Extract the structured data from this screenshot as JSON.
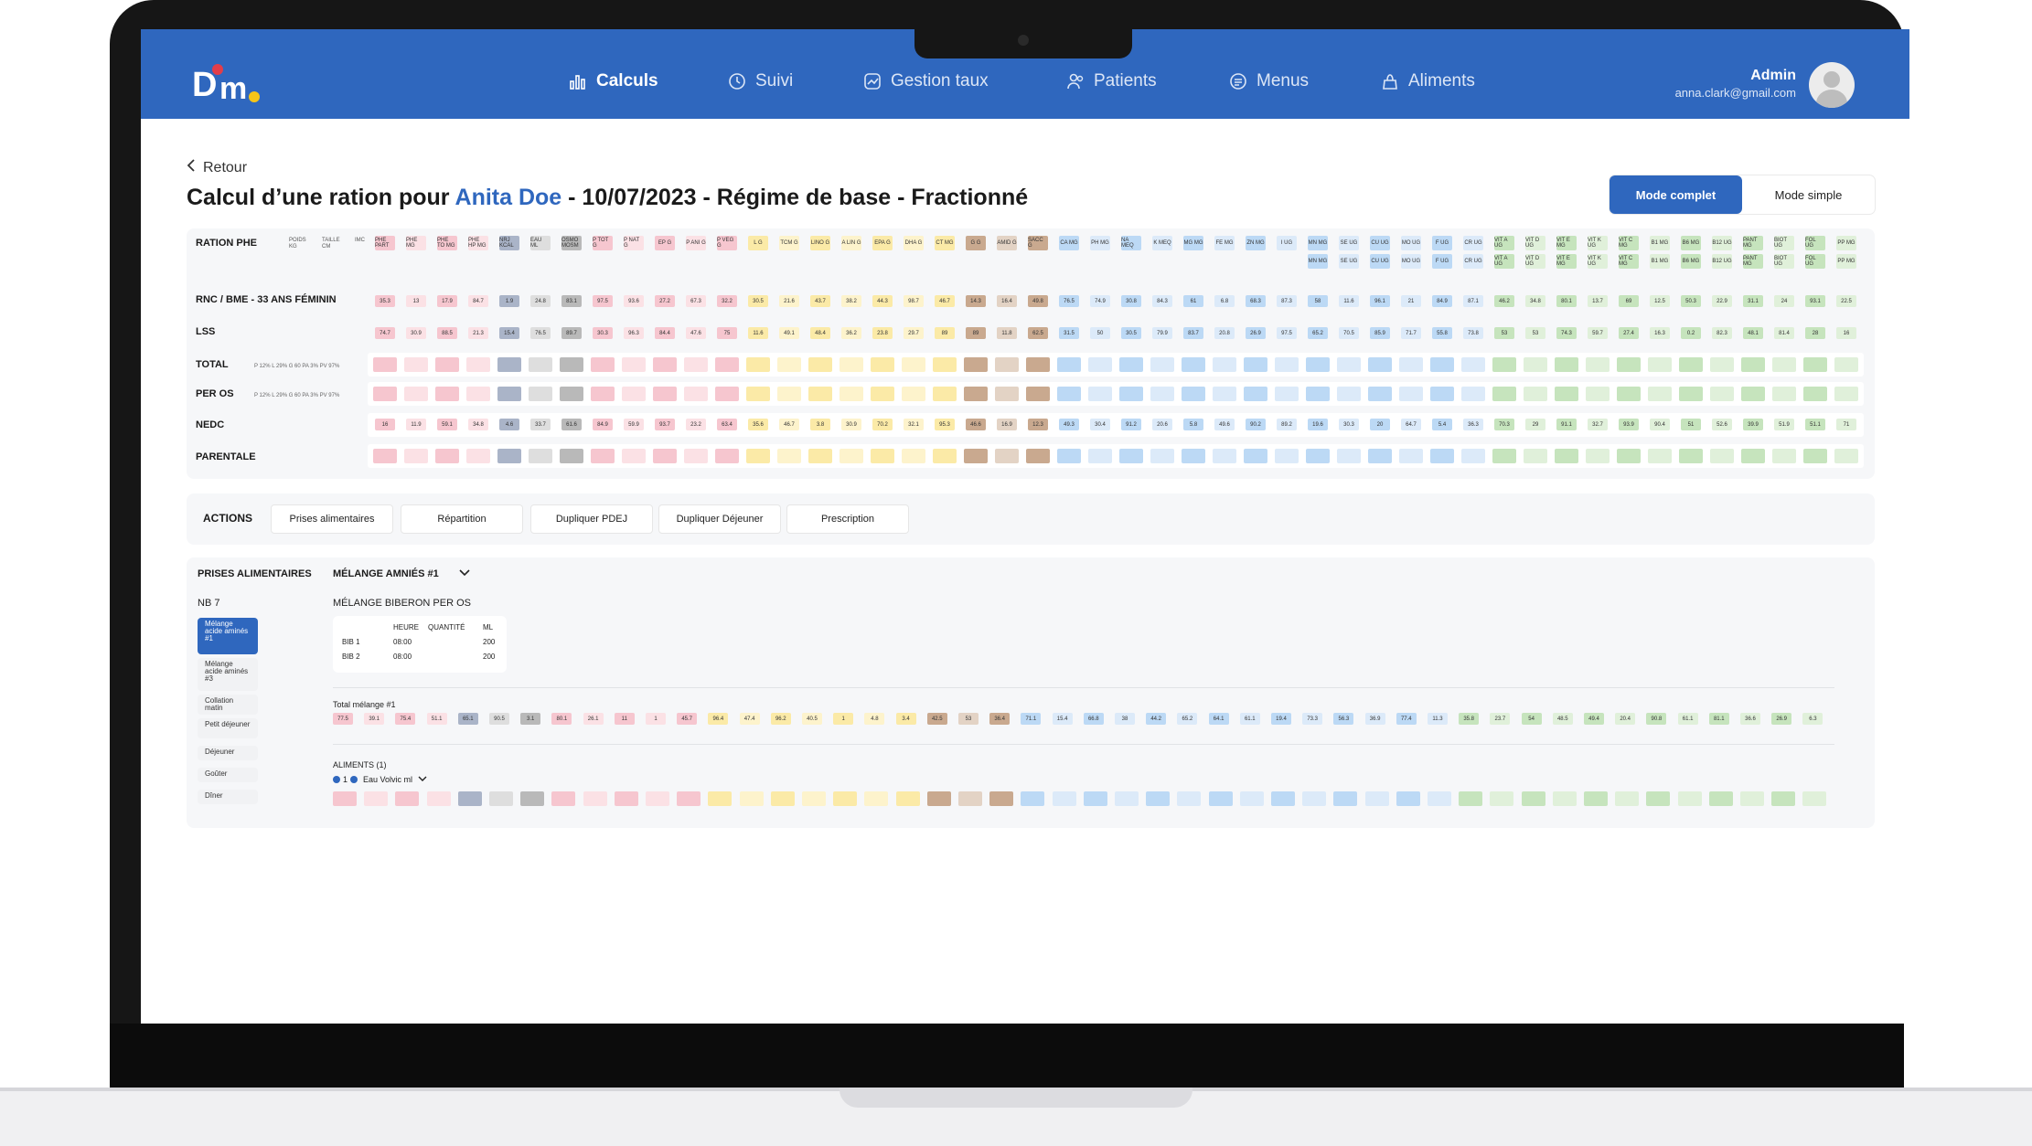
{
  "header": {
    "nav": [
      {
        "label": "Calculs",
        "icon": "bar-chart-icon",
        "active": true
      },
      {
        "label": "Suivi",
        "icon": "clock-icon",
        "active": false
      },
      {
        "label": "Gestion taux",
        "icon": "trend-icon",
        "active": false
      },
      {
        "label": "Patients",
        "icon": "users-icon",
        "active": false
      },
      {
        "label": "Menus",
        "icon": "menu-icon",
        "active": false
      },
      {
        "label": "Aliments",
        "icon": "food-icon",
        "active": false
      }
    ],
    "user_name": "Admin",
    "user_email": "anna.clark@gmail.com"
  },
  "page": {
    "back_label": "Retour",
    "title_prefix": "Calcul d’une ration pour ",
    "patient": "Anita Doe",
    "title_suffix": " - 10/07/2023 - Régime de base - Fractionné",
    "mode_complet": "Mode complet",
    "mode_simple": "Mode simple"
  },
  "table": {
    "header_label": "RATION PHE",
    "pre_columns": [
      "POIDS KG",
      "TAILLE CM",
      "IMC"
    ],
    "columns": [
      "PHE PART",
      "PHE MG",
      "PHE TO MG",
      "PHE HP MG",
      "NRJ KCAL",
      "EAU ML",
      "OSMO MOSM",
      "P TOT G",
      "P NAT G",
      "EP G",
      "P ANI G",
      "P VEG G",
      "L G",
      "TCM G",
      "LINO G",
      "A LIN G",
      "EPA G",
      "DHA G",
      "CT MG",
      "G G",
      "AMID G",
      "SACC G",
      "CA MG",
      "PH MG",
      "NA MEQ",
      "K MEQ",
      "MG MG",
      "FE MG",
      "ZN MG",
      "I UG",
      "MN MG",
      "SE UG",
      "CU UG",
      "MO UG",
      "F UG",
      "CR UG",
      "VIT A UG",
      "VIT D UG",
      "VIT E MG",
      "VIT K UG",
      "VIT C MG",
      "B1 MG",
      "B6 MG",
      "B12 UG",
      "PANT MG",
      "BIOT UG",
      "FOL UG",
      "PP MG"
    ],
    "header_second_row": [
      "MN MG",
      "SE UG",
      "CU UG",
      "MO UG",
      "F UG",
      "CR UG",
      "VIT A UG",
      "VIT D UG",
      "VIT E MG",
      "VIT K UG",
      "VIT C MG",
      "B1 MG",
      "B6 MG",
      "B12 UG",
      "PANT MG",
      "BIOT UG",
      "FOL UG",
      "PP MG"
    ],
    "row_labels": [
      "RNC / BME - 33 ANS FÉMININ",
      "LSS",
      "TOTAL",
      "PER OS",
      "NEDC",
      "PARENTALE"
    ],
    "total_sub": "P 12%   L 29%   G 60   PA 3%   PV 97%",
    "per_os_sub": "P 12%   L 29%   G 60   PA 3%   PV 97%",
    "rnc": [
      "35.3",
      "13",
      "17.9",
      "84.7",
      "1.9",
      "24.8",
      "83.1",
      "97.5",
      "93.6",
      "27.2",
      "67.3",
      "32.2",
      "30.5",
      "21.6",
      "43.7",
      "38.2",
      "44.3",
      "98.7",
      "46.7",
      "14.3",
      "16.4",
      "49.8",
      "76.5",
      "74.9",
      "30.8",
      "84.3",
      "61",
      "6.8",
      "68.3",
      "87.3",
      "58",
      "11.6",
      "96.1",
      "21",
      "84.9",
      "87.1",
      "46.2",
      "34.8",
      "80.1",
      "13.7",
      "69",
      "12.5",
      "50.3",
      "22.9",
      "31.1",
      "24",
      "93.1",
      "22.5"
    ],
    "lss": [
      "74.7",
      "30.9",
      "88.5",
      "21.3",
      "15.4",
      "76.5",
      "89.7",
      "30.3",
      "96.3",
      "84.4",
      "47.6",
      "75",
      "11.6",
      "49.1",
      "48.4",
      "36.2",
      "23.8",
      "29.7",
      "89",
      "89",
      "11.8",
      "62.5",
      "31.5",
      "50",
      "30.5",
      "79.9",
      "83.7",
      "20.8",
      "26.9",
      "97.5",
      "65.2",
      "70.5",
      "85.9",
      "71.7",
      "55.8",
      "73.8",
      "53",
      "53",
      "74.3",
      "59.7",
      "27.4",
      "16.3",
      "0.2",
      "82.3",
      "48.1",
      "81.4",
      "28",
      "16"
    ],
    "nedc": [
      "16",
      "11.9",
      "59.1",
      "34.8",
      "4.6",
      "33.7",
      "61.6",
      "84.9",
      "59.9",
      "93.7",
      "23.2",
      "63.4",
      "35.6",
      "46.7",
      "3.8",
      "30.9",
      "70.2",
      "32.1",
      "95.3",
      "46.6",
      "16.9",
      "12.3",
      "49.3",
      "30.4",
      "91.2",
      "20.6",
      "5.8",
      "49.6",
      "90.2",
      "89.2",
      "19.6",
      "30.3",
      "20",
      "64.7",
      "5.4",
      "36.3",
      "70.3",
      "29",
      "91.1",
      "32.7",
      "93.9",
      "90.4",
      "51",
      "52.6",
      "39.9",
      "51.9",
      "51.1",
      "71"
    ],
    "colors": [
      "#f6c6cf",
      "#fbe1e5",
      "#f6c6cf",
      "#fbe1e5",
      "#aab4c8",
      "#dedede",
      "#b9b9b9",
      "#f6c6cf",
      "#fbe1e5",
      "#f6c6cf",
      "#fbe1e5",
      "#f6c6cf",
      "#fbeaa7",
      "#fdf3cc",
      "#fbeaa7",
      "#fdf3cc",
      "#fbeaa7",
      "#fdf3cc",
      "#fbeaa7",
      "#c9a98f",
      "#e3d3c5",
      "#c9a98f",
      "#bcd9f5",
      "#dceaf9",
      "#bcd9f5",
      "#dceaf9",
      "#bcd9f5",
      "#dceaf9",
      "#bcd9f5",
      "#dceaf9",
      "#bcd9f5",
      "#dceaf9",
      "#bcd9f5",
      "#dceaf9",
      "#bcd9f5",
      "#dceaf9",
      "#c6e4bd",
      "#e0f0da",
      "#c6e4bd",
      "#e0f0da",
      "#c6e4bd",
      "#e0f0da",
      "#c6e4bd",
      "#e0f0da",
      "#c6e4bd",
      "#e0f0da",
      "#c6e4bd",
      "#e0f0da"
    ]
  },
  "actions": {
    "label": "ACTIONS",
    "buttons": [
      "Prises alimentaires",
      "Répartition",
      "Dupliquer PDEJ",
      "Dupliquer Déjeuner",
      "Prescription"
    ]
  },
  "prises": {
    "label": "PRISES ALIMENTAIRES",
    "selected": "MÉLANGE AMNIÉS #1",
    "nb": "NB 7",
    "side": [
      "Mélange acide aminés #1",
      "Mélange acide aminés #3",
      "Collation matin",
      "Petit déjeuner",
      "Déjeuner",
      "Goûter",
      "Dîner"
    ],
    "mix_title": "MÉLANGE BIBERON PER OS",
    "bib_headers": [
      "HEURE",
      "QUANTITÉ",
      "ML"
    ],
    "bibs": [
      {
        "name": "BIB 1",
        "heure": "08:00",
        "ml": "200"
      },
      {
        "name": "BIB 2",
        "heure": "08:00",
        "ml": "200"
      }
    ],
    "total_label": "Total mélange #1",
    "total_values": [
      "77.5",
      "39.1",
      "75.4",
      "51.1",
      "65.1",
      "90.5",
      "3.1",
      "80.1",
      "26.1",
      "11",
      "1",
      "45.7",
      "96.4",
      "47.4",
      "96.2",
      "40.5",
      "1",
      "4.8",
      "3.4",
      "42.5",
      "53",
      "36.4",
      "71.1",
      "15.4",
      "66.8",
      "38",
      "44.2",
      "65.2",
      "64.1",
      "61.1",
      "19.4",
      "73.3",
      "56.3",
      "36.9",
      "77.4",
      "11.3",
      "35.8",
      "23.7",
      "54",
      "48.5",
      "49.4",
      "20.4",
      "90.8",
      "61.1",
      "81.1",
      "36.6",
      "26.9",
      "6.3"
    ],
    "aliments_label": "ALIMENTS (1)",
    "aliment_name": "Eau Volvic ml",
    "aliment_count": "1"
  }
}
